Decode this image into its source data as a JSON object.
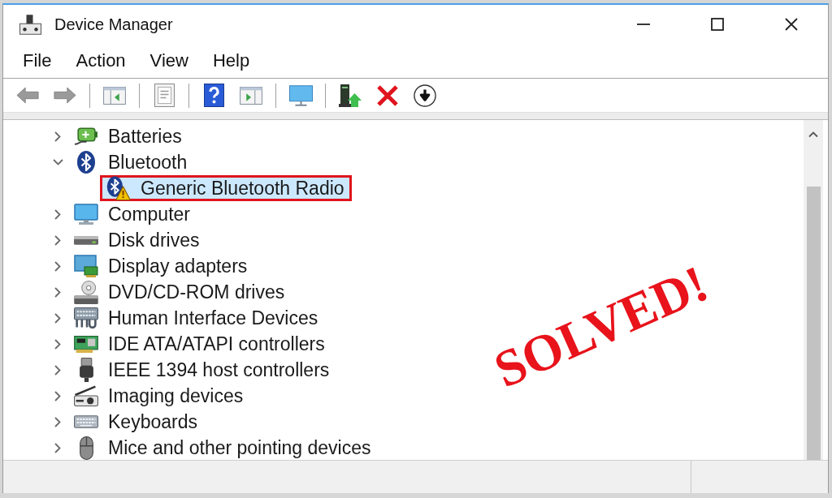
{
  "window": {
    "title": "Device Manager"
  },
  "menu": [
    "File",
    "Action",
    "View",
    "Help"
  ],
  "toolbar": {
    "groups": [
      [
        {
          "kind": "back",
          "disabled": true
        },
        {
          "kind": "forward",
          "disabled": true
        }
      ],
      [
        {
          "kind": "console-tree",
          "disabled": false
        }
      ],
      [
        {
          "kind": "properties",
          "disabled": false
        }
      ],
      [
        {
          "kind": "help",
          "disabled": false
        },
        {
          "kind": "action-pane",
          "disabled": false
        }
      ],
      [
        {
          "kind": "scan",
          "disabled": false
        }
      ],
      [
        {
          "kind": "update-driver",
          "disabled": false
        },
        {
          "kind": "uninstall",
          "disabled": false
        },
        {
          "kind": "disable-device",
          "disabled": false
        }
      ]
    ]
  },
  "tree": {
    "items": [
      {
        "label": "Batteries",
        "kind": "battery",
        "expanded": false,
        "selected": false
      },
      {
        "label": "Bluetooth",
        "kind": "bluetooth",
        "expanded": true,
        "selected": false,
        "children": [
          {
            "label": "Generic Bluetooth Radio",
            "kind": "bluetooth",
            "warning": true,
            "selected": true,
            "callout": true
          }
        ]
      },
      {
        "label": "Computer",
        "kind": "computer",
        "expanded": false,
        "selected": false
      },
      {
        "label": "Disk drives",
        "kind": "disk",
        "expanded": false,
        "selected": false
      },
      {
        "label": "Display adapters",
        "kind": "display",
        "expanded": false,
        "selected": false
      },
      {
        "label": "DVD/CD-ROM drives",
        "kind": "dvd",
        "expanded": false,
        "selected": false
      },
      {
        "label": "Human Interface Devices",
        "kind": "hid",
        "expanded": false,
        "selected": false
      },
      {
        "label": "IDE ATA/ATAPI controllers",
        "kind": "ide",
        "expanded": false,
        "selected": false
      },
      {
        "label": "IEEE 1394 host controllers",
        "kind": "ieee",
        "expanded": false,
        "selected": false
      },
      {
        "label": "Imaging devices",
        "kind": "imaging",
        "expanded": false,
        "selected": false
      },
      {
        "label": "Keyboards",
        "kind": "keyboard",
        "expanded": false,
        "selected": false
      },
      {
        "label": "Mice and other pointing devices",
        "kind": "mouse",
        "expanded": false,
        "selected": false
      }
    ]
  },
  "stamp": "SOLVED!"
}
